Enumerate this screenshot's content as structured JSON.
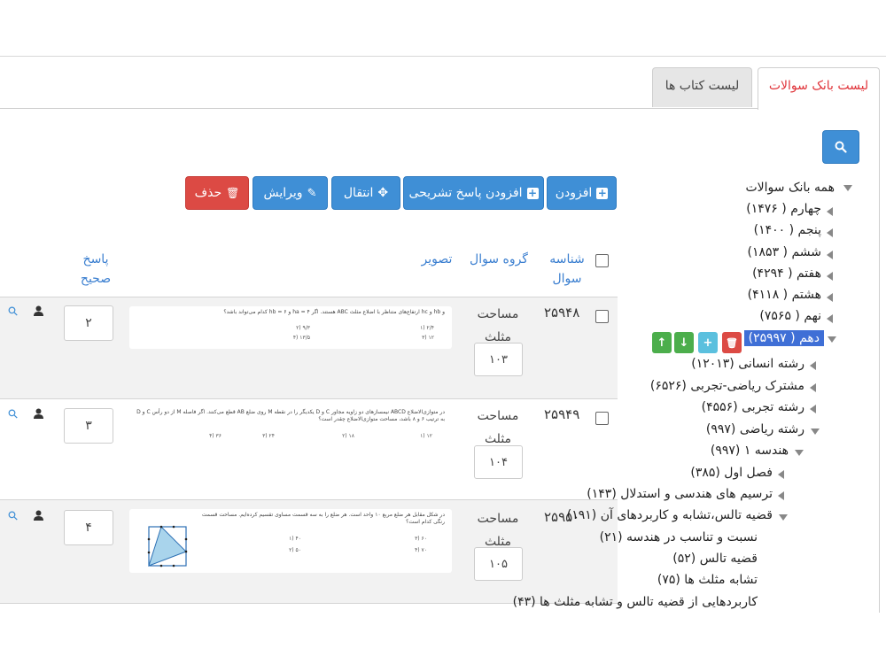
{
  "tabs": {
    "active": "لیست بانک سوالات",
    "inactive": "لیست کتاب ها"
  },
  "toolbar": {
    "add": "افزودن",
    "add_solution": "افزودن پاسخ تشریحی",
    "move": "انتقال",
    "edit": "ویرایش",
    "delete": "حذف"
  },
  "table": {
    "headers": {
      "id_line1": "شناسه",
      "id_line2": "سوال",
      "group": "گروه سوال",
      "image": "تصویر",
      "answer_line1": "پاسخ",
      "answer_line2": "صحیح"
    },
    "rows": [
      {
        "id": "۲۵۹۴۸",
        "group_line1": "مساحت",
        "group_line2": "مثلث",
        "number": "۱۰۳",
        "answer": "۲",
        "image_text": "و hb و hc ارتفاع‌های متناظر با اضلاع مثلث ABC هستند. اگر ۴ = ha و ۶ = hb کدام می‌تواند باشد؟",
        "opt1": "۱) ۲/۴",
        "opt2": "۲) ۹/۳",
        "opt3": "۳) ۱۲",
        "opt4": "۴) ۱۳/۵"
      },
      {
        "id": "۲۵۹۴۹",
        "group_line1": "مساحت",
        "group_line2": "مثلث",
        "number": "۱۰۴",
        "answer": "۳",
        "image_text": "در متوازی‌الاضلاع ABCD نیمسازهای دو زاویه مجاور C و D یکدیگر را در نقطه M روی ضلع AB قطع می‌کنند. اگر فاصله M از دو رأس C و D به ترتیب ۶ و ۸ باشد، مساحت متوازی‌الاضلاع چقدر است؟",
        "opt1": "۱) ۱۲",
        "opt2": "۲) ۱۸",
        "opt3": "۳) ۲۴",
        "opt4": "۴) ۳۶"
      },
      {
        "id": "۲۵۹۵۰",
        "group_line1": "مساحت",
        "group_line2": "مثلث",
        "number": "۱۰۵",
        "answer": "۴",
        "image_text": "در شکل مقابل هر ضلع مربع ۱۰ واحد است. هر ضلع را به سه قسمت مساوی تقسیم کرده‌ایم. مساحت قسمت رنگی کدام است؟",
        "opt1": "۱) ۴۰",
        "opt2": "۲) ۵۰",
        "opt3": "۳) ۶۰",
        "opt4": "۴) ۷۰"
      }
    ]
  },
  "tree": {
    "root": "همه بانک سوالات",
    "items": [
      "چهارم ( ۱۴۷۶)",
      "پنجم ( ۱۴۰۰)",
      "ششم ( ۱۸۵۳)",
      "هفتم ( ۴۲۹۴)",
      "هشتم ( ۴۱۱۸)",
      "نهم ( ۷۵۶۵)",
      "دهم ( ۲۵۹۹۷)",
      "رشته انسانی (۱۲۰۱۳)",
      "مشترک ریاضی-تجربی (۶۵۲۶)",
      "رشته تجربی (۴۵۵۶)",
      "رشته ریاضی (۹۹۷)",
      "هندسه ۱ (۹۹۷)",
      "فصل اول (۳۸۵)",
      "ترسیم های هندسی و استدلال (۱۴۳)",
      "قضیه تالس،تشابه و کاربردهای آن (۱۹۱)",
      "نسبت و تناسب در هندسه (۲۱)",
      "قضیه تالس (۵۲)",
      "تشابه مثلث ها (۷۵)",
      "کاربردهایی از قضیه تالس و تشابه مثلث ها (۴۳)"
    ]
  },
  "colors": {
    "primary": "#3f8fd6",
    "danger": "#dc4a44",
    "success": "#4cae4c",
    "info": "#5bc0de",
    "selected": "#3f6fd6",
    "active_tab_text": "#e0343a"
  }
}
